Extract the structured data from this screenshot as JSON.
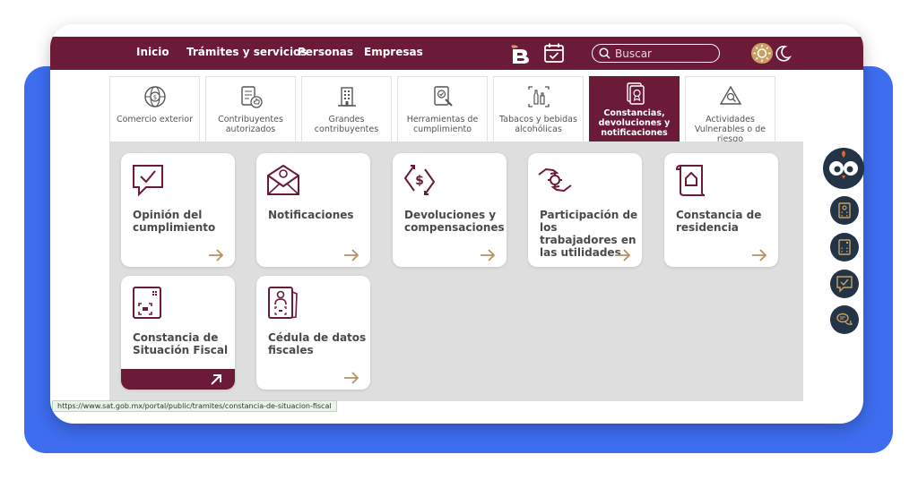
{
  "nav": {
    "links": [
      "Inicio",
      "Trámites y servicios",
      "Personas",
      "Empresas"
    ],
    "search_placeholder": "Buscar"
  },
  "tabs": [
    {
      "label": "Comercio exterior",
      "icon": "globe-dollar-icon"
    },
    {
      "label": "Contribuyentes autorizados",
      "icon": "document-thumbs-up-icon"
    },
    {
      "label": "Grandes contribuyentes",
      "icon": "building-icon"
    },
    {
      "label": "Herramientas de cumplimiento",
      "icon": "tools-check-icon"
    },
    {
      "label": "Tabacos y bebidas alcohólicas",
      "icon": "bottles-icon"
    },
    {
      "label": "Constancias, devoluciones y notificaciones",
      "icon": "certificate-icon",
      "active": true
    },
    {
      "label": "Actividades Vulnerables o de riesgo",
      "icon": "warning-search-icon"
    }
  ],
  "cards": [
    {
      "title": "Opinión del cumplimiento",
      "icon": "chat-check-icon"
    },
    {
      "title": "Notificaciones",
      "icon": "mail-bell-icon"
    },
    {
      "title": "Devoluciones y compensaciones",
      "icon": "refund-arrows-icon"
    },
    {
      "title": "Participación de los trabajadores en las utilidades",
      "icon": "hands-gear-icon"
    },
    {
      "title": "Constancia de residencia",
      "icon": "scroll-house-icon"
    },
    {
      "title": "Constancia de Situación Fiscal",
      "icon": "qr-document-icon",
      "active": true
    },
    {
      "title": "Cédula de datos fiscales",
      "icon": "id-card-icon"
    }
  ],
  "status_url": "https://www.sat.gob.mx/portal/public/tramites/constancia-de-situacion-fiscal",
  "colors": {
    "brand": "#6b1a38",
    "accent": "#c9a063",
    "panel": "#dedede",
    "backdrop": "#3e6df0",
    "tool": "#243447"
  }
}
